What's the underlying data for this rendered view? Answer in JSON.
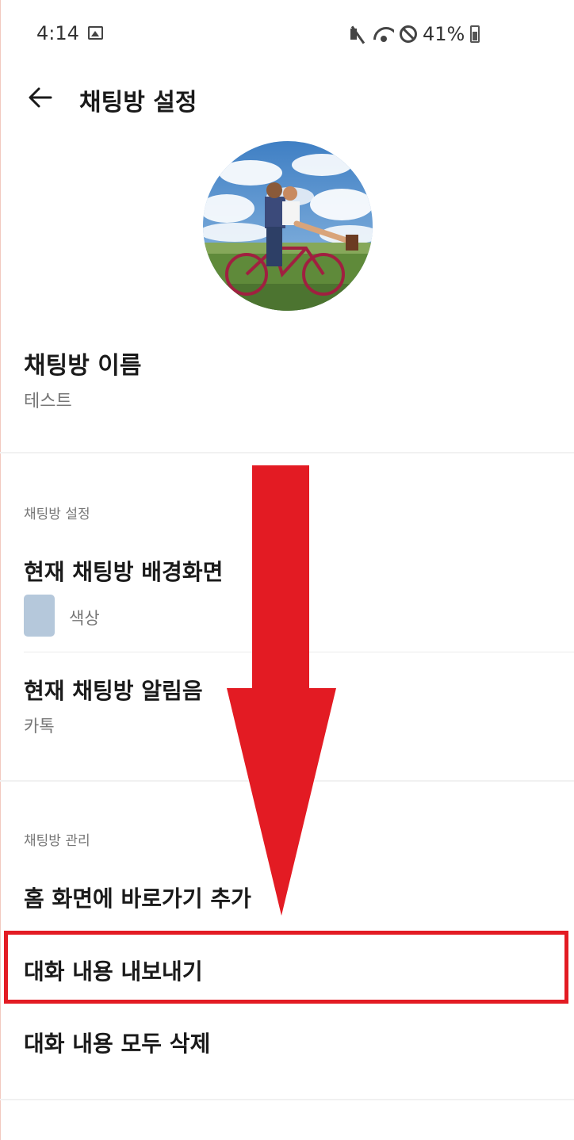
{
  "status_bar": {
    "time": "4:14",
    "battery": "41%",
    "icons": [
      "gallery-icon",
      "mute-icon",
      "wifi-icon",
      "do-not-disturb-icon",
      "battery-icon"
    ]
  },
  "header": {
    "back_icon": "arrow-left-icon",
    "title": "채팅방 설정"
  },
  "room_name": {
    "label": "채팅방 이름",
    "value": "테스트"
  },
  "settings_section": {
    "header": "채팅방 설정",
    "items": [
      {
        "title": "현재 채팅방 배경화면",
        "subtitle": "색상",
        "swatch_color": "#b5c8db"
      },
      {
        "title": "현재 채팅방 알림음",
        "subtitle": "카톡"
      }
    ]
  },
  "management_section": {
    "header": "채팅방 관리",
    "items": [
      {
        "title": "홈 화면에 바로가기 추가"
      },
      {
        "title": "대화 내용 내보내기",
        "highlighted": true
      },
      {
        "title": "대화 내용 모두 삭제"
      }
    ]
  },
  "annotation": {
    "arrow_color": "#e31b23",
    "highlight_color": "#e31b23"
  }
}
